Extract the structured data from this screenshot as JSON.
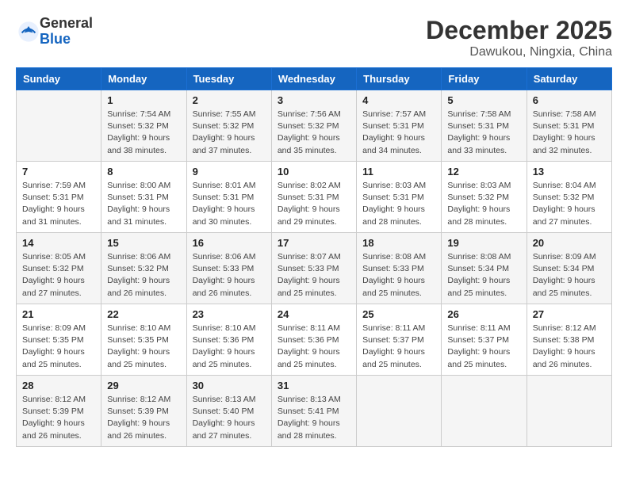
{
  "logo": {
    "general": "General",
    "blue": "Blue"
  },
  "title": "December 2025",
  "location": "Dawukou, Ningxia, China",
  "weekdays": [
    "Sunday",
    "Monday",
    "Tuesday",
    "Wednesday",
    "Thursday",
    "Friday",
    "Saturday"
  ],
  "weeks": [
    [
      {
        "date": "",
        "info": ""
      },
      {
        "date": "1",
        "info": "Sunrise: 7:54 AM\nSunset: 5:32 PM\nDaylight: 9 hours\nand 38 minutes."
      },
      {
        "date": "2",
        "info": "Sunrise: 7:55 AM\nSunset: 5:32 PM\nDaylight: 9 hours\nand 37 minutes."
      },
      {
        "date": "3",
        "info": "Sunrise: 7:56 AM\nSunset: 5:32 PM\nDaylight: 9 hours\nand 35 minutes."
      },
      {
        "date": "4",
        "info": "Sunrise: 7:57 AM\nSunset: 5:31 PM\nDaylight: 9 hours\nand 34 minutes."
      },
      {
        "date": "5",
        "info": "Sunrise: 7:58 AM\nSunset: 5:31 PM\nDaylight: 9 hours\nand 33 minutes."
      },
      {
        "date": "6",
        "info": "Sunrise: 7:58 AM\nSunset: 5:31 PM\nDaylight: 9 hours\nand 32 minutes."
      }
    ],
    [
      {
        "date": "7",
        "info": "Sunrise: 7:59 AM\nSunset: 5:31 PM\nDaylight: 9 hours\nand 31 minutes."
      },
      {
        "date": "8",
        "info": "Sunrise: 8:00 AM\nSunset: 5:31 PM\nDaylight: 9 hours\nand 31 minutes."
      },
      {
        "date": "9",
        "info": "Sunrise: 8:01 AM\nSunset: 5:31 PM\nDaylight: 9 hours\nand 30 minutes."
      },
      {
        "date": "10",
        "info": "Sunrise: 8:02 AM\nSunset: 5:31 PM\nDaylight: 9 hours\nand 29 minutes."
      },
      {
        "date": "11",
        "info": "Sunrise: 8:03 AM\nSunset: 5:31 PM\nDaylight: 9 hours\nand 28 minutes."
      },
      {
        "date": "12",
        "info": "Sunrise: 8:03 AM\nSunset: 5:32 PM\nDaylight: 9 hours\nand 28 minutes."
      },
      {
        "date": "13",
        "info": "Sunrise: 8:04 AM\nSunset: 5:32 PM\nDaylight: 9 hours\nand 27 minutes."
      }
    ],
    [
      {
        "date": "14",
        "info": "Sunrise: 8:05 AM\nSunset: 5:32 PM\nDaylight: 9 hours\nand 27 minutes."
      },
      {
        "date": "15",
        "info": "Sunrise: 8:06 AM\nSunset: 5:32 PM\nDaylight: 9 hours\nand 26 minutes."
      },
      {
        "date": "16",
        "info": "Sunrise: 8:06 AM\nSunset: 5:33 PM\nDaylight: 9 hours\nand 26 minutes."
      },
      {
        "date": "17",
        "info": "Sunrise: 8:07 AM\nSunset: 5:33 PM\nDaylight: 9 hours\nand 25 minutes."
      },
      {
        "date": "18",
        "info": "Sunrise: 8:08 AM\nSunset: 5:33 PM\nDaylight: 9 hours\nand 25 minutes."
      },
      {
        "date": "19",
        "info": "Sunrise: 8:08 AM\nSunset: 5:34 PM\nDaylight: 9 hours\nand 25 minutes."
      },
      {
        "date": "20",
        "info": "Sunrise: 8:09 AM\nSunset: 5:34 PM\nDaylight: 9 hours\nand 25 minutes."
      }
    ],
    [
      {
        "date": "21",
        "info": "Sunrise: 8:09 AM\nSunset: 5:35 PM\nDaylight: 9 hours\nand 25 minutes."
      },
      {
        "date": "22",
        "info": "Sunrise: 8:10 AM\nSunset: 5:35 PM\nDaylight: 9 hours\nand 25 minutes."
      },
      {
        "date": "23",
        "info": "Sunrise: 8:10 AM\nSunset: 5:36 PM\nDaylight: 9 hours\nand 25 minutes."
      },
      {
        "date": "24",
        "info": "Sunrise: 8:11 AM\nSunset: 5:36 PM\nDaylight: 9 hours\nand 25 minutes."
      },
      {
        "date": "25",
        "info": "Sunrise: 8:11 AM\nSunset: 5:37 PM\nDaylight: 9 hours\nand 25 minutes."
      },
      {
        "date": "26",
        "info": "Sunrise: 8:11 AM\nSunset: 5:37 PM\nDaylight: 9 hours\nand 25 minutes."
      },
      {
        "date": "27",
        "info": "Sunrise: 8:12 AM\nSunset: 5:38 PM\nDaylight: 9 hours\nand 26 minutes."
      }
    ],
    [
      {
        "date": "28",
        "info": "Sunrise: 8:12 AM\nSunset: 5:39 PM\nDaylight: 9 hours\nand 26 minutes."
      },
      {
        "date": "29",
        "info": "Sunrise: 8:12 AM\nSunset: 5:39 PM\nDaylight: 9 hours\nand 26 minutes."
      },
      {
        "date": "30",
        "info": "Sunrise: 8:13 AM\nSunset: 5:40 PM\nDaylight: 9 hours\nand 27 minutes."
      },
      {
        "date": "31",
        "info": "Sunrise: 8:13 AM\nSunset: 5:41 PM\nDaylight: 9 hours\nand 28 minutes."
      },
      {
        "date": "",
        "info": ""
      },
      {
        "date": "",
        "info": ""
      },
      {
        "date": "",
        "info": ""
      }
    ]
  ]
}
